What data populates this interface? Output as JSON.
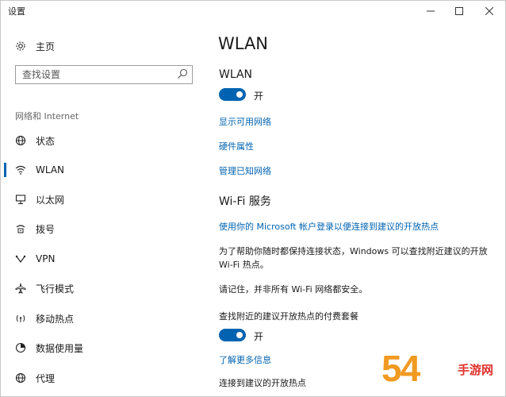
{
  "window": {
    "title": "设置",
    "minimize_glyph": "—",
    "maximize_glyph": "☐",
    "close_glyph": "✕"
  },
  "sidebar": {
    "home_label": "主页",
    "search_placeholder": "查找设置",
    "section_label": "网络和 Internet",
    "items": [
      {
        "label": "状态",
        "icon": "status-globe-icon"
      },
      {
        "label": "WLAN",
        "icon": "wifi-icon",
        "active": true
      },
      {
        "label": "以太网",
        "icon": "ethernet-icon"
      },
      {
        "label": "拨号",
        "icon": "dialup-icon"
      },
      {
        "label": "VPN",
        "icon": "vpn-icon"
      },
      {
        "label": "飞行模式",
        "icon": "airplane-icon"
      },
      {
        "label": "移动热点",
        "icon": "hotspot-icon"
      },
      {
        "label": "数据使用量",
        "icon": "data-usage-icon"
      },
      {
        "label": "代理",
        "icon": "proxy-globe-icon"
      }
    ]
  },
  "main": {
    "page_title": "WLAN",
    "wlan_heading": "WLAN",
    "wlan_toggle_state": "开",
    "links": {
      "show_networks": "显示可用网络",
      "hardware_props": "硬件属性",
      "manage_known": "管理已知网络"
    },
    "wifi_services_heading": "Wi-Fi 服务",
    "ms_account_link": "使用你的 Microsoft 帐户登录以便连接到建议的开放热点",
    "para1": "为了帮助你随时都保持连接状态，Windows 可以查找附近建议的开放 Wi-Fi 热点。",
    "para2": "请记住，并非所有 Wi-Fi 网络都安全。",
    "paid_plans_label": "查找附近的建议开放热点的付费套餐",
    "paid_toggle_state": "开",
    "learn_more_link": "了解更多信息",
    "connect_suggested_label": "连接到建议的开放热点"
  },
  "colors": {
    "accent": "#0063b1",
    "watermark_orange": "#f19a22",
    "watermark_red": "#e0322c"
  },
  "watermark": {
    "number": "54",
    "text": "手游网"
  }
}
